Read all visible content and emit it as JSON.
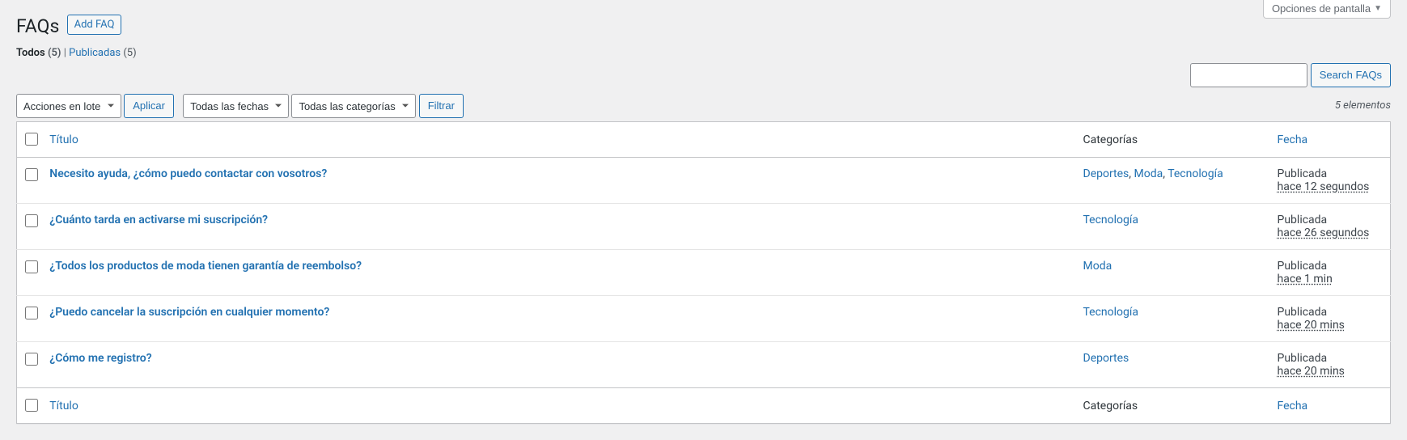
{
  "screen_options_label": "Opciones de pantalla",
  "page_title": "FAQs",
  "add_new_label": "Add FAQ",
  "views": {
    "all_label": "Todos",
    "all_count": "(5)",
    "sep": "|",
    "published_label": "Publicadas",
    "published_count": "(5)"
  },
  "search_button": "Search FAQs",
  "bulk_actions": {
    "select": "Acciones en lote",
    "apply": "Aplicar"
  },
  "filters": {
    "dates": "Todas las fechas",
    "categories": "Todas las categorías",
    "filter_btn": "Filtrar"
  },
  "item_count": "5 elementos",
  "columns": {
    "title": "Título",
    "categories": "Categorías",
    "date": "Fecha"
  },
  "rows": [
    {
      "title": "Necesito ayuda, ¿cómo puedo contactar con vosotros?",
      "cats": [
        "Deportes",
        "Moda",
        "Tecnología"
      ],
      "status": "Publicada",
      "time": "hace 12 segundos"
    },
    {
      "title": "¿Cuánto tarda en activarse mi suscripción?",
      "cats": [
        "Tecnología"
      ],
      "status": "Publicada",
      "time": "hace 26 segundos"
    },
    {
      "title": "¿Todos los productos de moda tienen garantía de reembolso?",
      "cats": [
        "Moda"
      ],
      "status": "Publicada",
      "time": "hace 1 min"
    },
    {
      "title": "¿Puedo cancelar la suscripción en cualquier momento?",
      "cats": [
        "Tecnología"
      ],
      "status": "Publicada",
      "time": "hace 20 mins"
    },
    {
      "title": "¿Cómo me registro?",
      "cats": [
        "Deportes"
      ],
      "status": "Publicada",
      "time": "hace 20 mins"
    }
  ]
}
